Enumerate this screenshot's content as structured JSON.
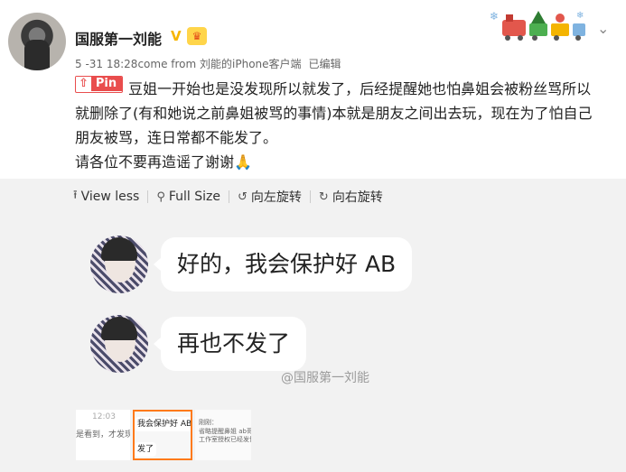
{
  "post": {
    "author": "国服第一刘能",
    "verified_mark": "V",
    "time": "5 -31 18:28",
    "source": "come from 刘能的iPhone客户端",
    "edited": "已编辑",
    "pin_label": "Pin",
    "text_line1": "豆姐一开始也是没发现所以就发了，后经提醒她也怕鼻姐会被粉丝骂所以",
    "text_line2": "就删除了(有和她说之前鼻姐被骂的事情)本就是朋友之间出去玩，现在为了怕自己",
    "text_line3": "朋友被骂，连日常都不能发了。",
    "text_line4": "请各位不要再造谣了谢谢🙏"
  },
  "toolbar": {
    "view_less": "View less",
    "full_size": "Full Size",
    "rotate_left": "向左旋转",
    "rotate_right": "向右旋转"
  },
  "chat": {
    "msg1": "好的，我会保护好 AB",
    "msg2": "再也不发了"
  },
  "watermark": "@国服第一刘能",
  "thumbnails": [
    {
      "line1": "12:03",
      "line2": "是看到，才发现。"
    },
    {
      "line1": "我会保护好 AB",
      "line2": "发了"
    },
    {
      "line1": "刚刚：",
      "line2": "省略提醒鼻姐 ab哥的",
      "line3": "工作室授权已经发博"
    }
  ],
  "colors": {
    "accent_orange": "#ff7a1a",
    "pin_red": "#e94d4d",
    "verified_gold": "#f7b500"
  }
}
